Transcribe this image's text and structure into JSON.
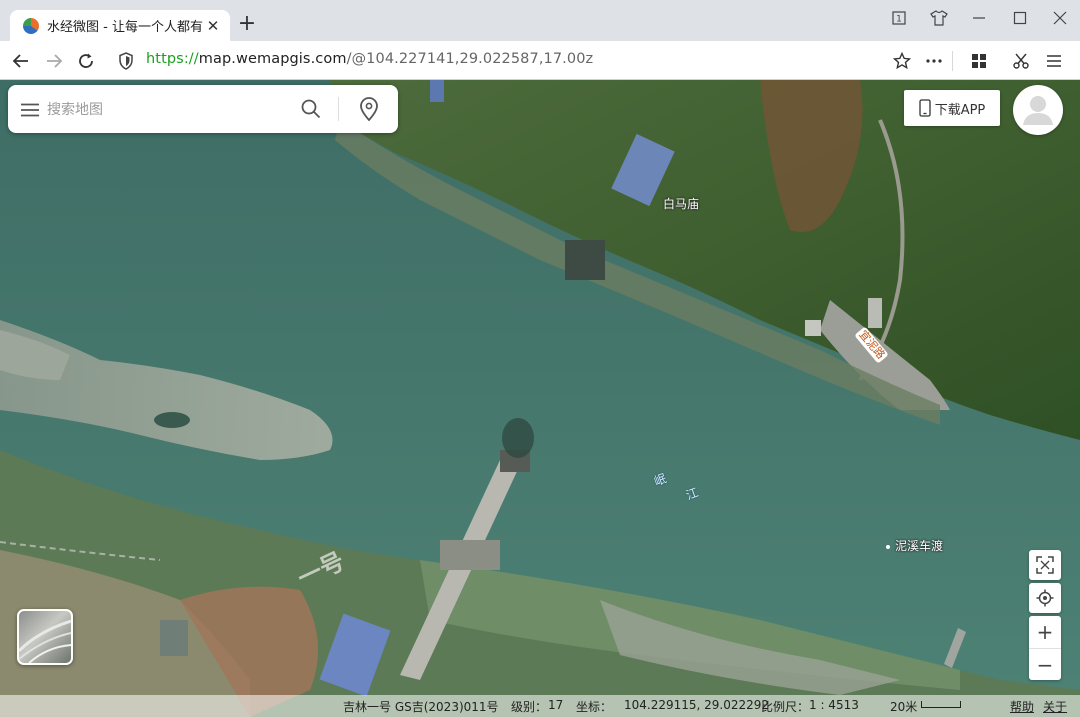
{
  "browser": {
    "tab_title": "水经微图 - 让每一个人都有自",
    "url": {
      "scheme": "https://",
      "host": "map.wemapgis.com",
      "path": "/@104.227141,29.022587,17.00z"
    }
  },
  "search": {
    "placeholder": "搜索地图"
  },
  "header": {
    "download_app_label": "下载APP"
  },
  "map_labels": {
    "place_baimamiao": "白马庙",
    "road_yinilu": "宜泥路",
    "river_char1": "岷",
    "river_char2": "江",
    "ferry": "泥溪车渡",
    "shadow_text": "一号"
  },
  "controls": {
    "zoom_in": "+",
    "zoom_out": "−"
  },
  "status": {
    "map_source": "吉林一号 GS吉(2023)011号",
    "level_label": "级别：",
    "level_value": "17",
    "coord_label": "坐标：",
    "coord_value": "104.229115, 29.022292",
    "scale_label": "比例尺：",
    "scale_value": "1 : 4513",
    "scalebar_text": "20米",
    "help": "帮助",
    "about": "关于"
  },
  "colors": {
    "url_scheme": "#19a11b",
    "road_label": "#c35a1b"
  }
}
